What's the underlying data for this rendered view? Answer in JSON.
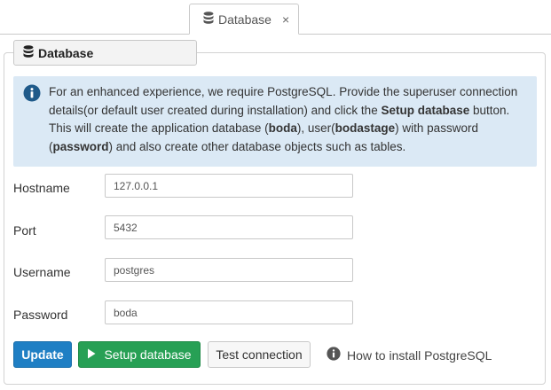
{
  "tab": {
    "label": "Database",
    "close_symbol": "×",
    "icon": "database-icon"
  },
  "panel": {
    "title": "Database",
    "icon": "database-icon"
  },
  "alert": {
    "icon": "info-circle-icon",
    "text_1": "For an enhanced experience, we require PostgreSQL. Provide the superuser connection details(or default user created during installation) and click the ",
    "bold_setup": "Setup database",
    "text_2": " button. This will create the application database (",
    "bold_db": "boda",
    "text_3": "), user(",
    "bold_user": "bodastage",
    "text_4": ") with password (",
    "bold_password": "password",
    "text_5": ") and also create other database objects such as tables.",
    "color_background": "#dbe9f5",
    "color_icon": "#1f5a8a"
  },
  "form": {
    "hostname": {
      "label": "Hostname",
      "value": "127.0.0.1"
    },
    "port": {
      "label": "Port",
      "value": "5432"
    },
    "username": {
      "label": "Username",
      "value": "postgres"
    },
    "password": {
      "label": "Password",
      "value": "boda"
    }
  },
  "buttons": {
    "update": {
      "label": "Update",
      "color": "#1f7fc4"
    },
    "setup": {
      "label": "Setup database",
      "icon": "play-icon",
      "color": "#27a055"
    },
    "test": {
      "label": "Test connection"
    }
  },
  "help_link": {
    "label": "How to install PostgreSQL",
    "icon": "info-circle-icon"
  }
}
